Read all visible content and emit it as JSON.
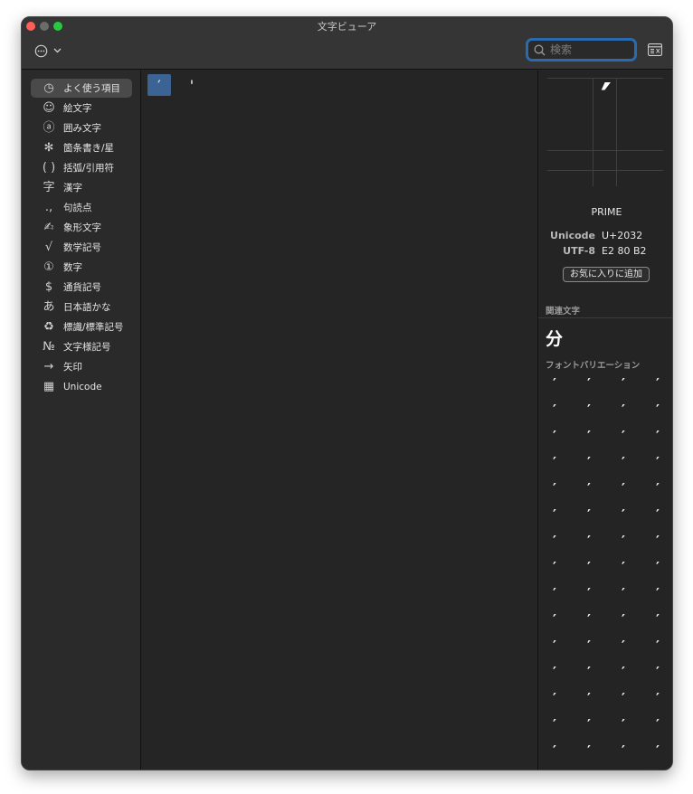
{
  "window": {
    "title": "文字ビューア"
  },
  "toolbar": {
    "menu_icon": "ellipsis-circle-icon",
    "search_placeholder": "検索",
    "sidepanel_icon": "sidebar-panel-icon"
  },
  "sidebar": {
    "items": [
      {
        "label": "よく使う項目",
        "icon": "◷",
        "selected": true
      },
      {
        "label": "絵文字",
        "icon": "☺",
        "selected": false
      },
      {
        "label": "囲み文字",
        "icon": "ⓐ",
        "selected": false
      },
      {
        "label": "箇条書き/星",
        "icon": "✻",
        "selected": false
      },
      {
        "label": "括弧/引用符",
        "icon": "( )",
        "selected": false
      },
      {
        "label": "漢字",
        "icon": "字",
        "selected": false
      },
      {
        "label": "句読点",
        "icon": ".,",
        "selected": false
      },
      {
        "label": "象形文字",
        "icon": "✍",
        "selected": false
      },
      {
        "label": "数学記号",
        "icon": "√",
        "selected": false
      },
      {
        "label": "数字",
        "icon": "①",
        "selected": false
      },
      {
        "label": "通貨記号",
        "icon": "$",
        "selected": false
      },
      {
        "label": "日本語かな",
        "icon": "あ",
        "selected": false
      },
      {
        "label": "標識/標準記号",
        "icon": "♻",
        "selected": false
      },
      {
        "label": "文字様記号",
        "icon": "№",
        "selected": false
      },
      {
        "label": "矢印",
        "icon": "→",
        "selected": false
      },
      {
        "label": "Unicode",
        "icon": "▦",
        "selected": false
      }
    ]
  },
  "grid": {
    "characters": [
      "′",
      "'"
    ],
    "selected_index": 0
  },
  "inspector": {
    "preview_glyph": "′",
    "name": "PRIME",
    "unicode_label": "Unicode",
    "unicode_value": "U+2032",
    "utf8_label": "UTF-8",
    "utf8_value": "E2 80 B2",
    "favorite_button": "お気に入りに追加",
    "related_title": "関連文字",
    "related_chars": [
      "分"
    ],
    "variations_title": "フォントバリエーション",
    "variations": [
      "′",
      "′",
      "′",
      "′",
      "′",
      "′",
      "′",
      "′",
      "′",
      "′",
      "′",
      "′",
      "′",
      "′",
      "′",
      "′",
      "′",
      "′",
      "′",
      "′",
      "′",
      "′",
      "′",
      "′",
      "′",
      "′",
      "′",
      "′",
      "′",
      "′",
      "′",
      "′",
      "′",
      "′",
      "′",
      "′",
      "′",
      "′",
      "′",
      "′",
      "′",
      "′",
      "′",
      "′",
      "′",
      "′",
      "′",
      "′",
      "′",
      "′",
      "′",
      "′",
      "′",
      "′",
      "′",
      "′",
      "′",
      "′",
      "′",
      "′",
      "′",
      "′",
      "′",
      "′"
    ]
  },
  "colors": {
    "accent": "#2a6bb0",
    "selection": "#3b6494",
    "window_bg": "#262626"
  }
}
